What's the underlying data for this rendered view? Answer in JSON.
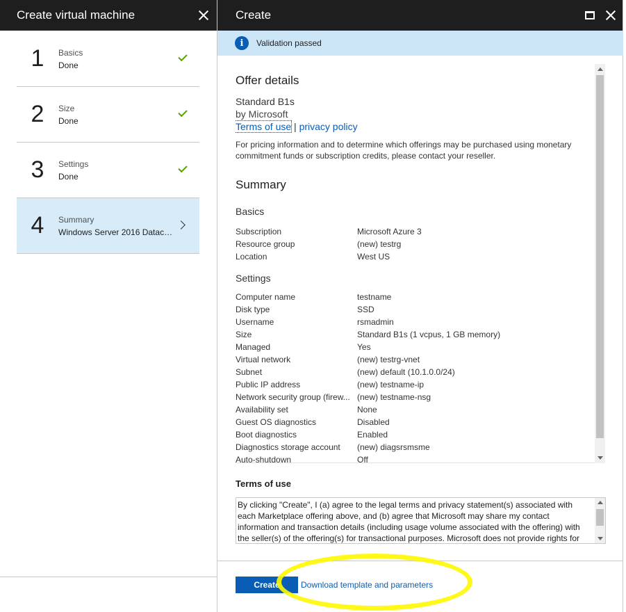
{
  "left_blade": {
    "title": "Create virtual machine",
    "steps": [
      {
        "number": "1",
        "label": "Basics",
        "status": "Done"
      },
      {
        "number": "2",
        "label": "Size",
        "status": "Done"
      },
      {
        "number": "3",
        "label": "Settings",
        "status": "Done"
      },
      {
        "number": "4",
        "label": "Summary",
        "status": "Windows Server 2016 Datacen..."
      }
    ]
  },
  "right_blade": {
    "title": "Create",
    "banner": "Validation passed",
    "offer": {
      "title": "Offer details",
      "name": "Standard B1s",
      "by": "by Microsoft",
      "terms_link": "Terms of use",
      "separator": "|",
      "privacy_link": "privacy policy",
      "pricing": "For pricing information and to determine which offerings may be purchased using monetary commitment funds or subscription credits, please contact your reseller."
    },
    "summary": {
      "title": "Summary",
      "basics_title": "Basics",
      "basics": [
        {
          "k": "Subscription",
          "v": "Microsoft Azure 3"
        },
        {
          "k": "Resource group",
          "v": "(new) testrg"
        },
        {
          "k": "Location",
          "v": "West US"
        }
      ],
      "settings_title": "Settings",
      "settings": [
        {
          "k": "Computer name",
          "v": "testname"
        },
        {
          "k": "Disk type",
          "v": "SSD"
        },
        {
          "k": "Username",
          "v": "rsmadmin"
        },
        {
          "k": "Size",
          "v": "Standard B1s (1 vcpus, 1 GB memory)"
        },
        {
          "k": "Managed",
          "v": "Yes"
        },
        {
          "k": "Virtual network",
          "v": "(new) testrg-vnet"
        },
        {
          "k": "Subnet",
          "v": "(new) default (10.1.0.0/24)"
        },
        {
          "k": "Public IP address",
          "v": "(new) testname-ip"
        },
        {
          "k": "Network security group (firew...",
          "v": "(new) testname-nsg"
        },
        {
          "k": "Availability set",
          "v": "None"
        },
        {
          "k": "Guest OS diagnostics",
          "v": "Disabled"
        },
        {
          "k": "Boot diagnostics",
          "v": "Enabled"
        },
        {
          "k": "Diagnostics storage account",
          "v": "(new) diagsrsmsme"
        },
        {
          "k": "Auto-shutdown",
          "v": "Off"
        }
      ]
    },
    "terms": {
      "title": "Terms of use",
      "text": "By clicking \"Create\", I (a) agree to the legal terms and privacy statement(s) associated with each Marketplace offering above, and (b) agree that Microsoft may share my contact information and transaction details (including usage volume associated with the offering) with the seller(s) of the offering(s) for transactional purposes. Microsoft does not provide rights for third-party products"
    },
    "footer": {
      "create_label": "Create",
      "download_label": "Download template and parameters"
    }
  },
  "colors": {
    "header_bg": "#1e1e1e",
    "banner_bg": "#cde6f7",
    "accent": "#0a5db4",
    "check": "#57a300",
    "highlight": "#fff800"
  }
}
